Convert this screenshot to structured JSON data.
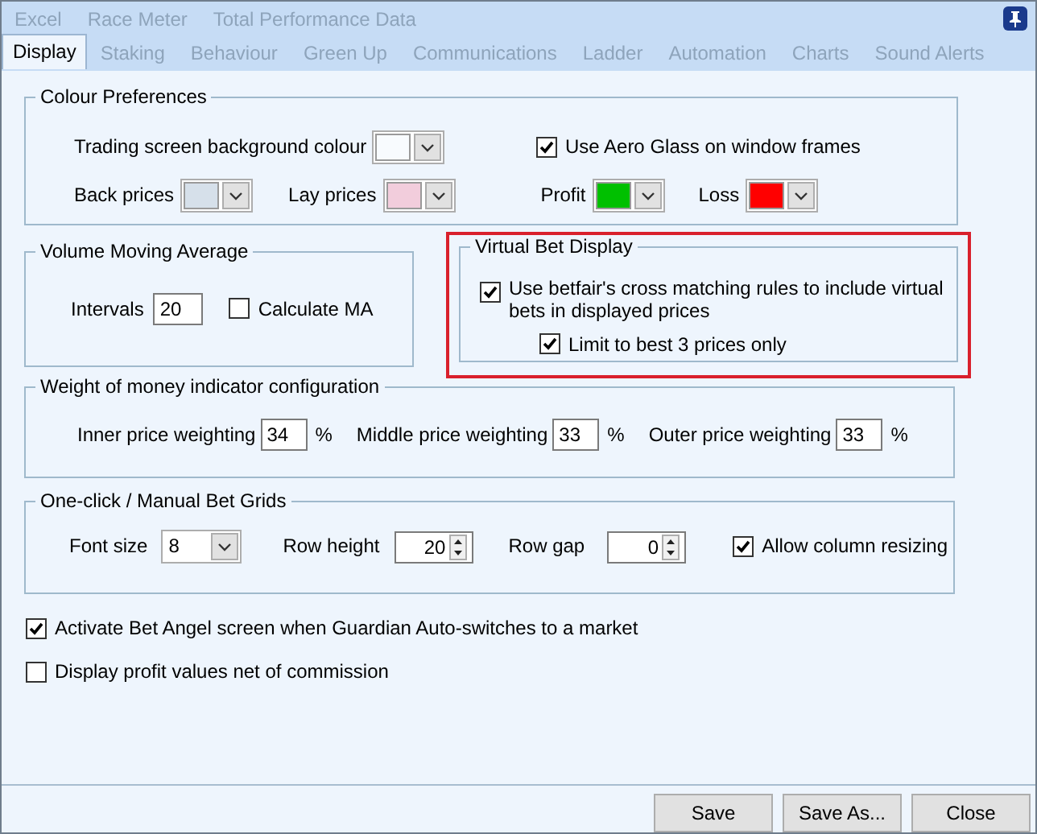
{
  "upper_tabs": [
    {
      "label": "Excel",
      "selected": false
    },
    {
      "label": "Race Meter",
      "selected": false
    },
    {
      "label": "Total Performance Data",
      "selected": false
    }
  ],
  "tabs": [
    {
      "label": "Display",
      "selected": true
    },
    {
      "label": "Staking",
      "selected": false
    },
    {
      "label": "Behaviour",
      "selected": false
    },
    {
      "label": "Green Up",
      "selected": false
    },
    {
      "label": "Communications",
      "selected": false
    },
    {
      "label": "Ladder",
      "selected": false
    },
    {
      "label": "Automation",
      "selected": false
    },
    {
      "label": "Charts",
      "selected": false
    },
    {
      "label": "Sound Alerts",
      "selected": false
    }
  ],
  "colour_preferences": {
    "title": "Colour Preferences",
    "background": {
      "label": "Trading screen background colour",
      "color": "#f8fbfe"
    },
    "aero_glass": {
      "label": "Use Aero Glass on window frames",
      "checked": true
    },
    "price_colours": [
      {
        "label": "Back prices",
        "color": "#d6e0ea"
      },
      {
        "label": "Lay prices",
        "color": "#f2cddc"
      },
      {
        "label": "Profit",
        "color": "#00c000"
      },
      {
        "label": "Loss",
        "color": "#ff0000"
      }
    ]
  },
  "volume_moving_average": {
    "title": "Volume Moving Average",
    "intervals_label": "Intervals",
    "intervals": "20",
    "calculate_ma": {
      "label": "Calculate MA",
      "checked": false
    }
  },
  "virtual_bet_display": {
    "title": "Virtual Bet Display",
    "highlighted": true,
    "options": [
      {
        "label": "Use betfair's cross matching rules to include virtual bets in displayed prices",
        "checked": true,
        "children": [
          {
            "label": "Limit to best 3 prices only",
            "checked": true
          }
        ]
      }
    ]
  },
  "weight_of_money": {
    "title": "Weight of money indicator configuration",
    "weightings": [
      {
        "label": "Inner price weighting",
        "value": "34",
        "unit": "%"
      },
      {
        "label": "Middle price weighting",
        "value": "33",
        "unit": "%"
      },
      {
        "label": "Outer price weighting",
        "value": "33",
        "unit": "%"
      }
    ]
  },
  "bet_grids": {
    "title": "One-click / Manual Bet Grids",
    "font_size": {
      "label": "Font size",
      "value": "8"
    },
    "spinners": [
      {
        "label": "Row height",
        "value": "20"
      },
      {
        "label": "Row gap",
        "value": "0"
      }
    ],
    "allow_resizing": {
      "label": "Allow column resizing",
      "checked": true
    }
  },
  "options": [
    {
      "label": "Activate Bet Angel screen when Guardian Auto-switches to a market",
      "checked": true
    },
    {
      "label": "Display profit values net of commission",
      "checked": false
    }
  ],
  "buttons": [
    "Save",
    "Save As...",
    "Close"
  ]
}
